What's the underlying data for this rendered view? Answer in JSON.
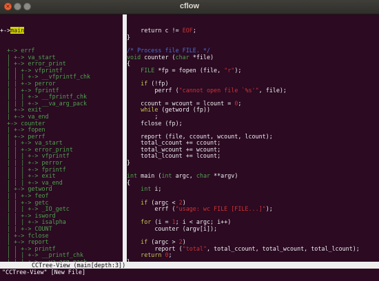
{
  "window": {
    "title": "cflow"
  },
  "tree": {
    "root_prefix": "+->",
    "root_label": "main",
    "lines": [
      "  +-> errf",
      "  | +-> va_start",
      "  | +-> error_print",
      "  | | +-> vfprintf",
      "  | | | +-> __vfprintf_chk",
      "  | | +-> perror",
      "  | | +-> fprintf",
      "  | | | +-> __fprintf_chk",
      "  | | | +-> __va_arg_pack",
      "  | +-> exit",
      "  | +-> va_end",
      "  +-> counter",
      "  | +-> fopen",
      "  | +-> perrf",
      "  | | +-> va_start",
      "  | | +-> error_print",
      "  | | | +-> vfprintf",
      "  | | | +-> perror",
      "  | | | +-> fprintf",
      "  | | | +-> exit",
      "  | | | +-> va_end",
      "  | +-> getword",
      "  | | +-> feof",
      "  | | +-> getc",
      "  | | | +-> _IO_getc",
      "  | | +-> isword",
      "  | | | +-> isalpha",
      "  | | +-> COUNT",
      "  | +-> fclose",
      "  | +-> report",
      "  | | +-> printf",
      "  | | | +-> __printf_chk",
      "  | | | +-> __va_arg_pack",
      "  +-> report",
      "  | +-> printf",
      "  | | +-> __printf_chk"
    ]
  },
  "code": {
    "lines": [
      [
        {
          "t": "    return c != ",
          "c": ""
        },
        {
          "t": "EOF",
          "c": "str"
        },
        {
          "t": ";",
          "c": ""
        }
      ],
      [
        {
          "t": "}",
          "c": "brace"
        }
      ],
      [
        {
          "t": "",
          "c": ""
        }
      ],
      [
        {
          "t": "/* Process file FILE. */",
          "c": "cm"
        }
      ],
      [
        {
          "t": "void",
          "c": "ty"
        },
        {
          "t": " counter (",
          "c": ""
        },
        {
          "t": "char",
          "c": "ty"
        },
        {
          "t": " *file)",
          "c": ""
        }
      ],
      [
        {
          "t": "{",
          "c": "brace"
        }
      ],
      [
        {
          "t": "    ",
          "c": ""
        },
        {
          "t": "FILE",
          "c": "ty"
        },
        {
          "t": " *fp = fopen (file, ",
          "c": ""
        },
        {
          "t": "\"r\"",
          "c": "str"
        },
        {
          "t": ");",
          "c": ""
        }
      ],
      [
        {
          "t": "",
          "c": ""
        }
      ],
      [
        {
          "t": "    ",
          "c": ""
        },
        {
          "t": "if",
          "c": "kw"
        },
        {
          "t": " (!fp)",
          "c": ""
        }
      ],
      [
        {
          "t": "        perrf (",
          "c": ""
        },
        {
          "t": "\"cannot open file `%s'\"",
          "c": "str"
        },
        {
          "t": ", file);",
          "c": ""
        }
      ],
      [
        {
          "t": "",
          "c": ""
        }
      ],
      [
        {
          "t": "    ccount = wcount = lcount = ",
          "c": ""
        },
        {
          "t": "0",
          "c": "str"
        },
        {
          "t": ";",
          "c": ""
        }
      ],
      [
        {
          "t": "    ",
          "c": ""
        },
        {
          "t": "while",
          "c": "kw"
        },
        {
          "t": " (getword (fp))",
          "c": ""
        }
      ],
      [
        {
          "t": "        ;",
          "c": ""
        }
      ],
      [
        {
          "t": "    fclose (fp);",
          "c": ""
        }
      ],
      [
        {
          "t": "",
          "c": ""
        }
      ],
      [
        {
          "t": "    report (file, ccount, wcount, lcount);",
          "c": ""
        }
      ],
      [
        {
          "t": "    total_ccount += ccount;",
          "c": ""
        }
      ],
      [
        {
          "t": "    total_wcount += wcount;",
          "c": ""
        }
      ],
      [
        {
          "t": "    total_lcount += lcount;",
          "c": ""
        }
      ],
      [
        {
          "t": "}",
          "c": "brace"
        }
      ],
      [
        {
          "t": "",
          "c": ""
        }
      ],
      [
        {
          "t": "int",
          "c": "ty"
        },
        {
          "t": " main (",
          "c": ""
        },
        {
          "t": "int",
          "c": "ty"
        },
        {
          "t": " argc, ",
          "c": ""
        },
        {
          "t": "char",
          "c": "ty"
        },
        {
          "t": " **argv)",
          "c": ""
        }
      ],
      [
        {
          "t": "{",
          "c": "brace"
        }
      ],
      [
        {
          "t": "    ",
          "c": ""
        },
        {
          "t": "int",
          "c": "ty"
        },
        {
          "t": " i;",
          "c": ""
        }
      ],
      [
        {
          "t": "",
          "c": ""
        }
      ],
      [
        {
          "t": "    ",
          "c": ""
        },
        {
          "t": "if",
          "c": "kw"
        },
        {
          "t": " (argc < ",
          "c": ""
        },
        {
          "t": "2",
          "c": "str"
        },
        {
          "t": ")",
          "c": ""
        }
      ],
      [
        {
          "t": "        errf (",
          "c": ""
        },
        {
          "t": "\"usage: wc FILE [FILE...]\"",
          "c": "str"
        },
        {
          "t": ");",
          "c": ""
        }
      ],
      [
        {
          "t": "",
          "c": ""
        }
      ],
      [
        {
          "t": "    ",
          "c": ""
        },
        {
          "t": "for",
          "c": "kw"
        },
        {
          "t": " (i = ",
          "c": ""
        },
        {
          "t": "1",
          "c": "str"
        },
        {
          "t": "; i < argc; i++)",
          "c": ""
        }
      ],
      [
        {
          "t": "        counter (argv[i]);",
          "c": ""
        }
      ],
      [
        {
          "t": "",
          "c": ""
        }
      ],
      [
        {
          "t": "    ",
          "c": ""
        },
        {
          "t": "if",
          "c": "kw"
        },
        {
          "t": " (argc > ",
          "c": ""
        },
        {
          "t": "2",
          "c": "str"
        },
        {
          "t": ")",
          "c": ""
        }
      ],
      [
        {
          "t": "        report (",
          "c": ""
        },
        {
          "t": "\"total\"",
          "c": "str"
        },
        {
          "t": ", total_ccount, total_wcount, total_lcount);",
          "c": ""
        }
      ],
      [
        {
          "t": "    ",
          "c": ""
        },
        {
          "t": "return",
          "c": "kw"
        },
        {
          "t": " ",
          "c": ""
        },
        {
          "t": "0",
          "c": "str"
        },
        {
          "t": ";",
          "c": ""
        }
      ],
      [
        {
          "t": "}",
          "c": "brace"
        }
      ]
    ]
  },
  "statusline": {
    "text": "CCTree-View (main[depth:3])"
  },
  "cmdline": {
    "text": "\"CCTree-View\" [New File]"
  }
}
